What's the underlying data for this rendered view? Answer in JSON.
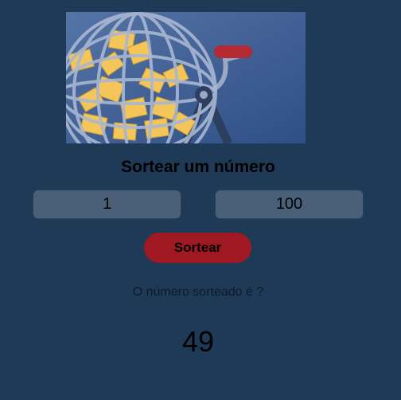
{
  "hero": {
    "image": "bingo-cage-illustration"
  },
  "title": "Sortear um número",
  "inputs": {
    "min_value": "1",
    "max_value": "100"
  },
  "button": {
    "label": "Sortear"
  },
  "result": {
    "label": "O número sorteado é ?",
    "value": "49"
  },
  "colors": {
    "background": "#1f3a57",
    "input_bg": "#4a6079",
    "button_bg": "#a01822",
    "text": "#000000"
  }
}
